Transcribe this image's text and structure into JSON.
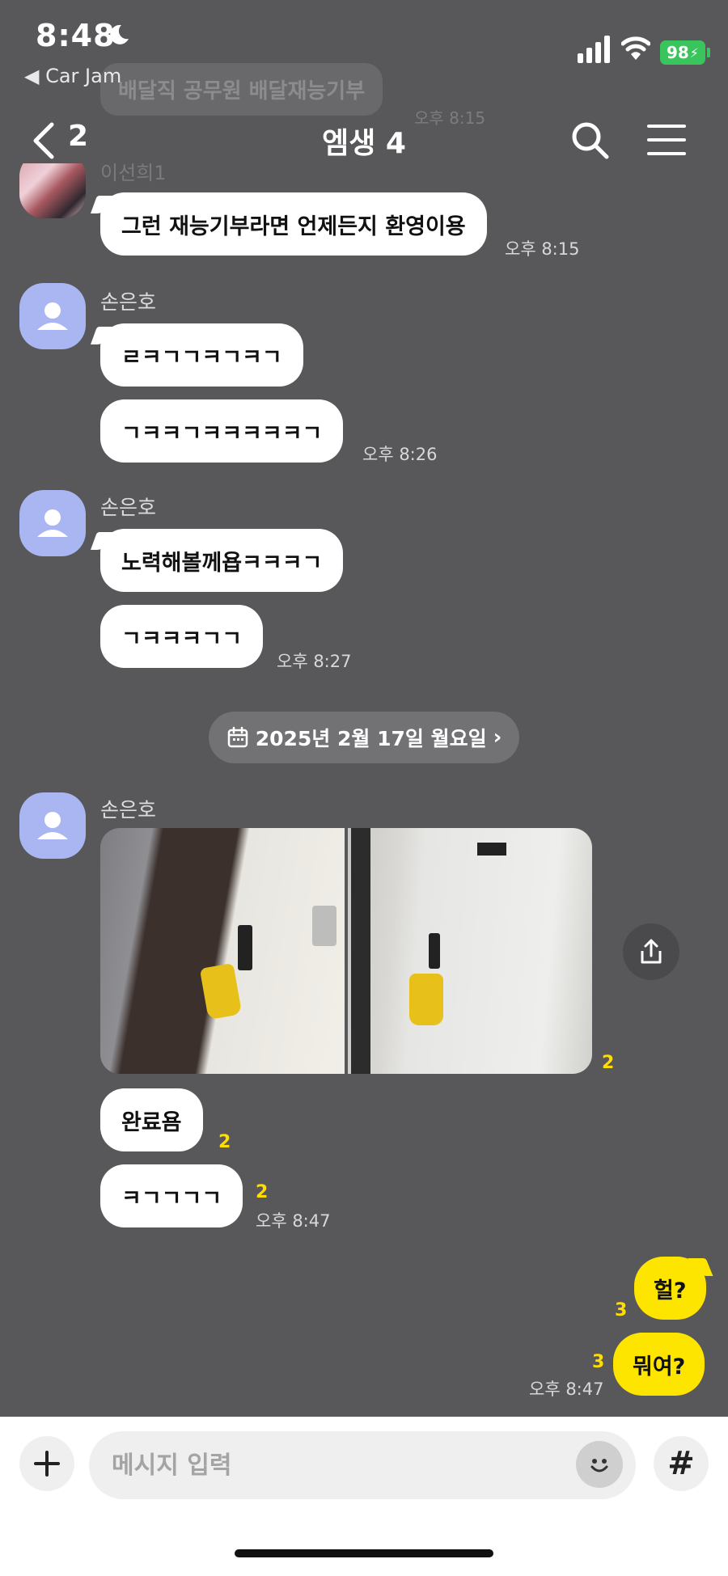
{
  "status_bar": {
    "time": "8:48",
    "back_app": "◀ Car Jam",
    "battery": "98"
  },
  "faded": {
    "message": "배달직 공무원 배달재능기부",
    "time": "오후 8:15",
    "sender": "이선희1"
  },
  "header": {
    "back_count": "2",
    "title": "엠생 4"
  },
  "messages": {
    "m1": {
      "text": "그런 재능기부라면 언제든지 환영이용",
      "time": "오후 8:15"
    },
    "g2": {
      "sender": "손은호",
      "b1": "ㄹㅋㄱㄱㅋㄱㅋㄱ",
      "b2": "ㄱㅋㅋㄱㅋㅋㅋㅋㅋㄱ",
      "time": "오후 8:26"
    },
    "g3": {
      "sender": "손은호",
      "b1": "노력해볼께욥ㅋㅋㅋㄱ",
      "b2": "ㄱㅋㅋㅋㄱㄱ",
      "time": "오후 8:27"
    },
    "date_divider": "2025년 2월 17일 월요일",
    "g4": {
      "sender": "손은호",
      "photo_unread": "2",
      "b1": "완료욤",
      "b1_unread": "2",
      "b2": "ㅋㄱㄱㄱㄱ",
      "b2_unread": "2",
      "time": "오후 8:47"
    },
    "mine": {
      "b1": "헐?",
      "b1_unread": "3",
      "b2": "뭐여?",
      "b2_unread": "3",
      "time": "오후 8:47"
    }
  },
  "input": {
    "placeholder": "메시지 입력"
  },
  "icons": {
    "moon": "moon-icon",
    "signal": "signal-icon",
    "wifi": "wifi-icon",
    "back": "chevron-left-icon",
    "search": "search-icon",
    "menu": "menu-icon",
    "calendar": "calendar-icon",
    "share": "share-icon",
    "plus": "plus-icon",
    "emoji": "emoji-icon",
    "hash": "hash-icon"
  },
  "colors": {
    "background": "#58585a",
    "my_bubble": "#fee500",
    "unread": "#ffdd00",
    "avatar": "#a9b6f2"
  }
}
